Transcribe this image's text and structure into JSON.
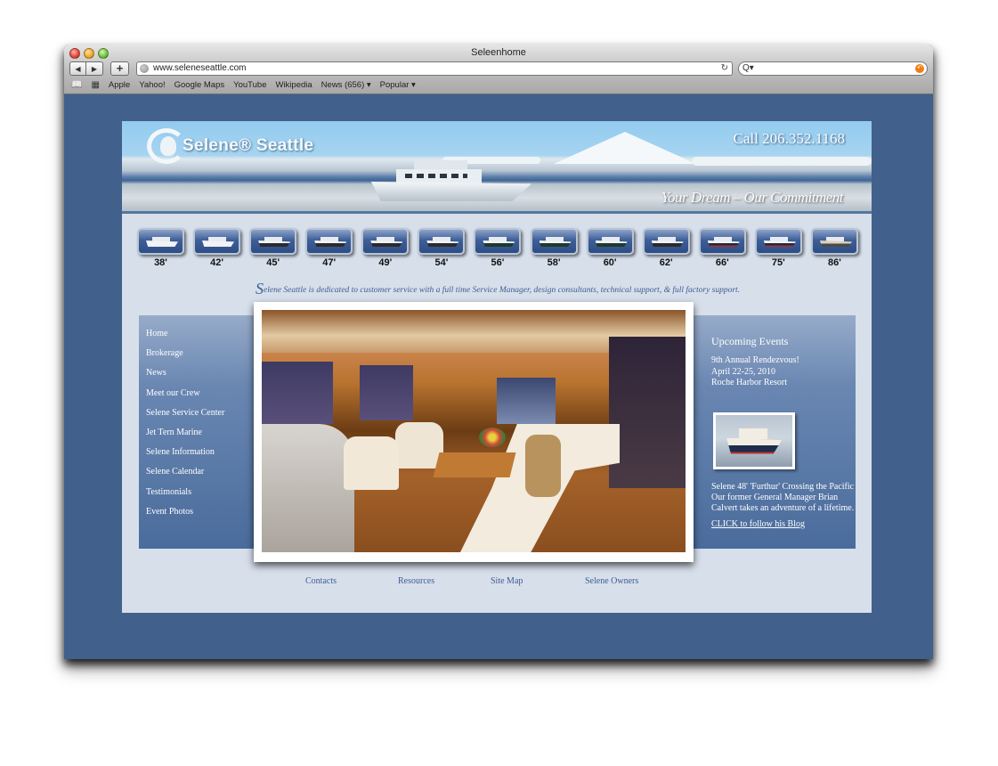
{
  "browser": {
    "window_title": "Seleenhome",
    "url": "www.seleneseattle.com",
    "search_placeholder": "",
    "back_icon": "◀",
    "forward_icon": "▶",
    "add_icon": "+",
    "reload_icon": "↻",
    "search_icon": "Q▾",
    "snapback_icon": "↶",
    "bookmarks_icon": "📖",
    "topsites_icon": "▦",
    "bookmarks": [
      "Apple",
      "Yahoo!",
      "Google Maps",
      "YouTube",
      "Wikipedia",
      "News (656) ▾",
      "Popular ▾"
    ]
  },
  "site": {
    "brand": "Selene® Seattle",
    "phone": "Call  206.352.1168",
    "tagline": "Your Dream – Our Commitment",
    "models": [
      {
        "label": "38'",
        "hull": "white"
      },
      {
        "label": "42'",
        "hull": "white"
      },
      {
        "label": "45'",
        "hull": "black"
      },
      {
        "label": "47'",
        "hull": "black"
      },
      {
        "label": "49'",
        "hull": "black"
      },
      {
        "label": "54'",
        "hull": "black"
      },
      {
        "label": "56'",
        "hull": "green"
      },
      {
        "label": "58'",
        "hull": "green"
      },
      {
        "label": "60'",
        "hull": "green"
      },
      {
        "label": "62'",
        "hull": "black"
      },
      {
        "label": "66'",
        "hull": "dark"
      },
      {
        "label": "75'",
        "hull": "dark"
      },
      {
        "label": "86'",
        "hull": "tan"
      }
    ],
    "mission_initial": "S",
    "mission_rest": "elene Seattle is dedicated to customer service with a full time Service Manager, design consultants, technical support, & full factory support.",
    "nav": [
      "Home",
      "Brokerage",
      "News",
      "Meet our Crew",
      "Selene Service Center",
      "Jet Tern Marine",
      "Selene Information",
      "Selene Calendar",
      "Testimonials",
      "Event Photos"
    ],
    "events": {
      "title": "Upcoming Events",
      "line1": "9th Annual Rendezvous!",
      "line2": "April 22-25, 2010",
      "line3": "Roche Harbor Resort",
      "blog_text": "Selene 48' 'Furthur' Crossing the Pacific Our former General Manager Brian Calvert takes an adventure of a lifetime.",
      "blog_link": "CLICK to follow his Blog"
    },
    "footer": [
      "Contacts",
      "Resources",
      "Site Map",
      "Selene Owners"
    ]
  }
}
